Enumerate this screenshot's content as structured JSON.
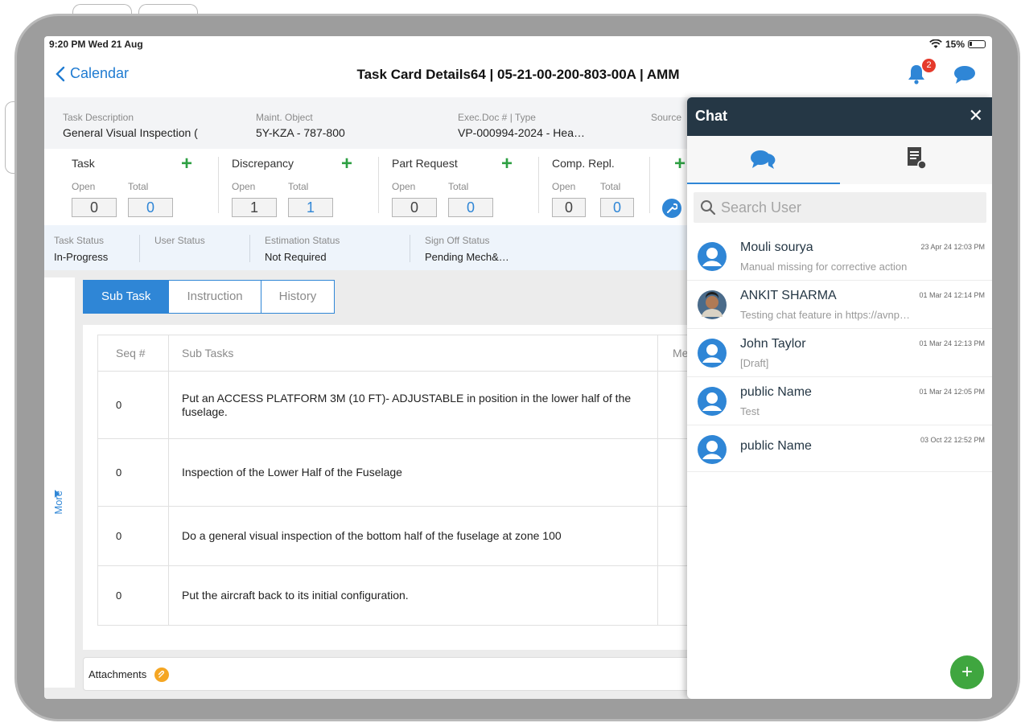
{
  "statusbar": {
    "time": "9:20 PM  Wed 21 Aug",
    "battery": "15%"
  },
  "nav": {
    "back_label": "Calendar",
    "title": "Task Card Details64 | 05-21-00-200-803-00A | AMM",
    "notification_count": "2"
  },
  "info": {
    "task_description_label": "Task Description",
    "task_description_value": "General Visual Inspection (",
    "maint_object_label": "Maint. Object",
    "maint_object_value": "5Y-KZA - 787-800",
    "exec_doc_label": "Exec.Doc # | Type",
    "exec_doc_value": "VP-000994-2024 - Hea…",
    "source_label": "Source"
  },
  "counters": [
    {
      "title": "Task",
      "open_label": "Open",
      "total_label": "Total",
      "open": "0",
      "total": "0"
    },
    {
      "title": "Discrepancy",
      "open_label": "Open",
      "total_label": "Total",
      "open": "1",
      "total": "1"
    },
    {
      "title": "Part Request",
      "open_label": "Open",
      "total_label": "Total",
      "open": "0",
      "total": "0"
    },
    {
      "title": "Comp. Repl.",
      "open_label": "Open",
      "total_label": "Total",
      "open": "0",
      "total": "0"
    }
  ],
  "status": {
    "task_status_label": "Task Status",
    "task_status_value": "In-Progress",
    "user_status_label": "User Status",
    "estimation_status_label": "Estimation Status",
    "estimation_status_value": "Not Required",
    "sign_off_status_label": "Sign Off Status",
    "sign_off_status_value": "Pending Mech&…"
  },
  "more_label": "More",
  "tabs": [
    "Sub Task",
    "Instruction",
    "History"
  ],
  "table": {
    "headers": [
      "Seq #",
      "Sub Tasks",
      "Me"
    ],
    "rows": [
      {
        "seq": "0",
        "text": "Put an ACCESS PLATFORM 3M (10 FT)- ADJUSTABLE in position in the lower half of the fuselage."
      },
      {
        "seq": "0",
        "text": "Inspection of the Lower Half of the Fuselage"
      },
      {
        "seq": "0",
        "text": "Do a general visual inspection of the bottom half of the fuselage at zone 100"
      },
      {
        "seq": "0",
        "text": "Put the aircraft back to its initial configuration."
      }
    ]
  },
  "attachments_label": "Attachments",
  "chat": {
    "title": "Chat",
    "search_placeholder": "Search User",
    "conversations": [
      {
        "name": "Mouli sourya",
        "message": "Manual missing for corrective action",
        "time": "23 Apr 24 12:03 PM"
      },
      {
        "name": "ANKIT SHARMA",
        "message": "Testing chat feature in https://avnp…",
        "time": "01 Mar 24 12:14 PM"
      },
      {
        "name": "John Taylor",
        "message": "[Draft]",
        "time": "01 Mar 24 12:13 PM"
      },
      {
        "name": "public Name",
        "message": "Test",
        "time": "01 Mar 24 12:05 PM"
      },
      {
        "name": "public Name",
        "message": "",
        "time": "03 Oct 22 12:52 PM"
      }
    ]
  },
  "colors": {
    "accent": "#2f86d6",
    "chat_header": "#253745",
    "plus_green": "#2ea043",
    "fab_green": "#3fa63f",
    "badge_red": "#e53a2b"
  }
}
